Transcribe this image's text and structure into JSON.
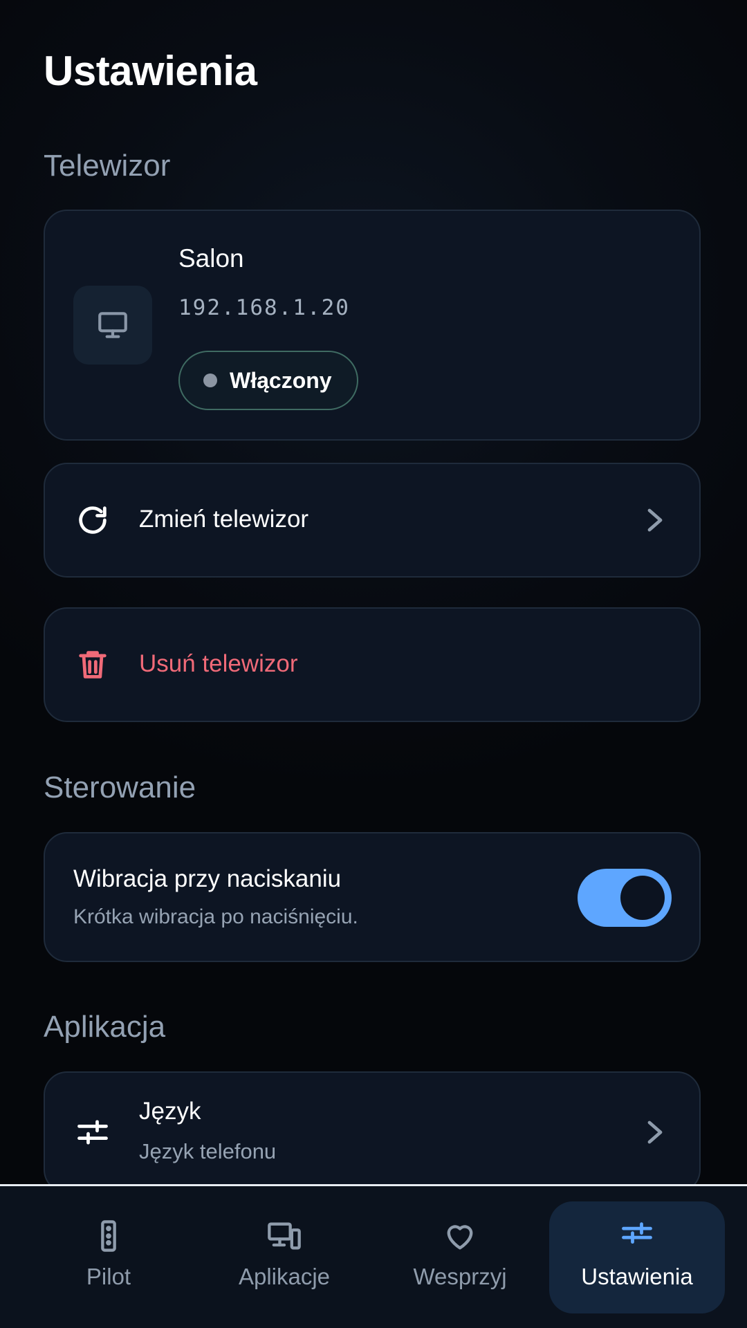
{
  "page": {
    "title": "Ustawienia"
  },
  "sections": {
    "tv": "Telewizor",
    "control": "Sterowanie",
    "app": "Aplikacja"
  },
  "tv": {
    "name": "Salon",
    "ip": "192.168.1.20",
    "status": "Włączony",
    "icon": "tv-icon"
  },
  "actions": {
    "change_label": "Zmień telewizor",
    "delete_label": "Usuń telewizor"
  },
  "vibration": {
    "title": "Wibracja przy naciskaniu",
    "subtitle": "Krótka wibracja po naciśnięciu.",
    "enabled": true
  },
  "language": {
    "title": "Język",
    "subtitle": "Język telefonu"
  },
  "nav": {
    "items": [
      {
        "label": "Pilot",
        "icon": "remote-icon",
        "active": false
      },
      {
        "label": "Aplikacje",
        "icon": "devices-icon",
        "active": false
      },
      {
        "label": "Wesprzyj",
        "icon": "heart-icon",
        "active": false
      },
      {
        "label": "Ustawienia",
        "icon": "sliders-icon",
        "active": true
      }
    ]
  },
  "colors": {
    "accent": "#5ea6ff",
    "danger": "#f06a78",
    "card": "#0d1523",
    "status_border": "#3f6b62"
  }
}
